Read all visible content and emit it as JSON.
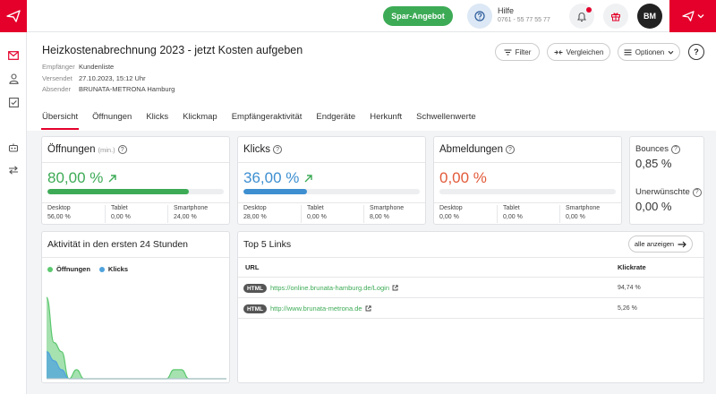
{
  "topbar": {
    "spar_label": "Spar-Angebot",
    "help_title": "Hilfe",
    "help_phone": "0761 - 55 77 55 77",
    "avatar_initials": "BM",
    "brand_color": "#e4002b",
    "icons": [
      "paper-plane-icon",
      "question-icon",
      "bell-icon",
      "gift-icon",
      "chevron-down-icon"
    ]
  },
  "sidebar": {
    "icons": [
      "mail-icon",
      "user-icon",
      "checklist-icon",
      "robot-icon",
      "swap-icon"
    ]
  },
  "header": {
    "title": "Heizkostenabrechnung 2023 - jetzt Kosten aufgeben",
    "meta": [
      {
        "label": "Empfänger",
        "value": "Kundenliste"
      },
      {
        "label": "Versendet",
        "value": "27.10.2023, 15:12 Uhr"
      },
      {
        "label": "Absender",
        "value": "BRUNATA-METRONA Hamburg"
      }
    ],
    "filter_label": "Filter",
    "compare_label": "Vergleichen",
    "options_label": "Optionen",
    "help_label": "?"
  },
  "tabs": [
    "Übersicht",
    "Öffnungen",
    "Klicks",
    "Klickmap",
    "Empfängeraktivität",
    "Endgeräte",
    "Herkunft",
    "Schwellenwerte"
  ],
  "openings": {
    "title": "Öffnungen",
    "suffix": "(min.)",
    "value": "80,00 %",
    "progress": 0.8,
    "color": "#3dab56",
    "devices": [
      {
        "label": "Desktop",
        "value": "56,00 %"
      },
      {
        "label": "Tablet",
        "value": "0,00 %"
      },
      {
        "label": "Smartphone",
        "value": "24,00 %"
      }
    ]
  },
  "clicks": {
    "title": "Klicks",
    "value": "36,00 %",
    "progress": 0.36,
    "color": "#3d8fd0",
    "devices": [
      {
        "label": "Desktop",
        "value": "28,00 %"
      },
      {
        "label": "Tablet",
        "value": "0,00 %"
      },
      {
        "label": "Smartphone",
        "value": "8,00 %"
      }
    ]
  },
  "unsubscribes": {
    "title": "Abmeldungen",
    "value": "0,00 %",
    "progress": 0,
    "color": "#e25a3a",
    "devices": [
      {
        "label": "Desktop",
        "value": "0,00 %"
      },
      {
        "label": "Tablet",
        "value": "0,00 %"
      },
      {
        "label": "Smartphone",
        "value": "0,00 %"
      }
    ]
  },
  "bounces": {
    "title": "Bounces",
    "value": "0,85 %"
  },
  "unwanted": {
    "title": "Unerwünschte",
    "value": "0,00 %"
  },
  "activity": {
    "title": "Aktivität in den ersten 24 Stunden",
    "legend": [
      {
        "name": "Öffnungen",
        "color": "#5cc86f"
      },
      {
        "name": "Klicks",
        "color": "#4fa3dd"
      }
    ]
  },
  "chart_data": {
    "type": "area",
    "title": "Aktivität in den ersten 24 Stunden",
    "x": [
      0,
      1,
      2,
      3,
      4,
      5,
      6,
      7,
      8,
      9,
      10,
      11,
      12,
      13,
      14,
      15,
      16,
      17,
      18,
      19,
      20,
      21,
      22,
      23,
      24
    ],
    "series": [
      {
        "name": "Öffnungen",
        "values": [
          9,
          4,
          3,
          0,
          1,
          0,
          0,
          0,
          0,
          0,
          0,
          0,
          0,
          0,
          0,
          0,
          0,
          1,
          1,
          0,
          0,
          0,
          0,
          0,
          0
        ]
      },
      {
        "name": "Klicks",
        "values": [
          3,
          2,
          1,
          0,
          0,
          0,
          0,
          0,
          0,
          0,
          0,
          0,
          0,
          0,
          0,
          0,
          0,
          0,
          0,
          0,
          0,
          0,
          0,
          0,
          0
        ]
      }
    ],
    "ylim": [
      0,
      10
    ],
    "grid": false,
    "legend": "top-left"
  },
  "links": {
    "title": "Top 5 Links",
    "show_all": "alle anzeigen",
    "col_url": "URL",
    "col_rate": "Klickrate",
    "rows": [
      {
        "badge": "HTML",
        "url": "https://online.brunata-hamburg.de/Login",
        "rate": "94,74 %"
      },
      {
        "badge": "HTML",
        "url": "http://www.brunata-metrona.de",
        "rate": "5,26 %"
      }
    ]
  }
}
